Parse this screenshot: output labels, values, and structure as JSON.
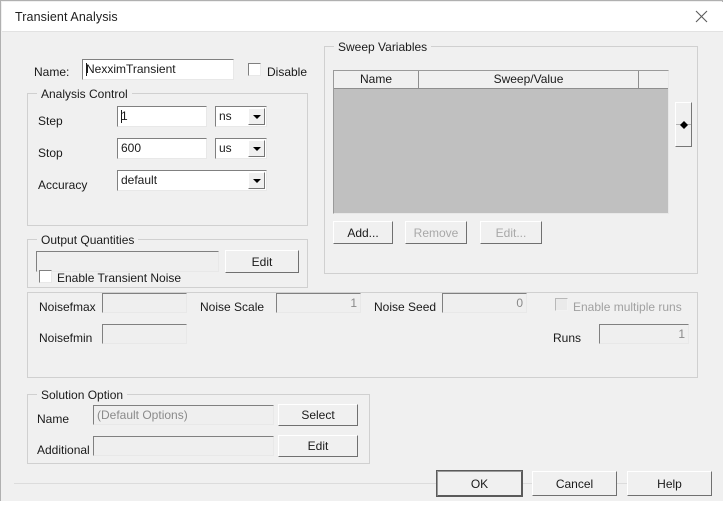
{
  "window": {
    "title": "Transient Analysis",
    "close_icon": "close-icon"
  },
  "name_row": {
    "label": "Name:",
    "value": "NexximTransient",
    "disable_label": "Disable",
    "disable_checked": false
  },
  "analysis_control": {
    "title": "Analysis Control",
    "step_label": "Step",
    "step_value": "1",
    "step_unit": "ns",
    "stop_label": "Stop",
    "stop_value": "600",
    "stop_unit": "us",
    "accuracy_label": "Accuracy",
    "accuracy_value": "default"
  },
  "output_quantities": {
    "title": "Output Quantities",
    "value": "",
    "edit_label": "Edit"
  },
  "sweep_variables": {
    "title": "Sweep Variables",
    "columns": [
      "Name",
      "Sweep/Value",
      ""
    ],
    "rows": [],
    "add_label": "Add...",
    "remove_label": "Remove",
    "edit_label": "Edit...",
    "add_enabled": true,
    "remove_enabled": false,
    "edit_enabled": false,
    "move_up_icon": "arrow-up-icon",
    "move_down_icon": "arrow-down-icon"
  },
  "transient_noise": {
    "enable_label": "Enable Transient Noise",
    "enable_checked": false,
    "noisefmax_label": "Noisefmax",
    "noisefmax_value": "",
    "noisefmin_label": "Noisefmin",
    "noisefmin_value": "",
    "noise_scale_label": "Noise Scale",
    "noise_scale_value": "1",
    "noise_seed_label": "Noise Seed",
    "noise_seed_value": "0",
    "multiple_runs_label": "Enable multiple runs",
    "multiple_runs_checked": false,
    "runs_label": "Runs",
    "runs_value": "1"
  },
  "solution_option": {
    "title": "Solution Option",
    "name_label": "Name",
    "name_value": "(Default Options)",
    "select_label": "Select",
    "additional_label": "Additional",
    "additional_value": "",
    "edit_label": "Edit"
  },
  "footer": {
    "ok_label": "OK",
    "cancel_label": "Cancel",
    "help_label": "Help"
  }
}
